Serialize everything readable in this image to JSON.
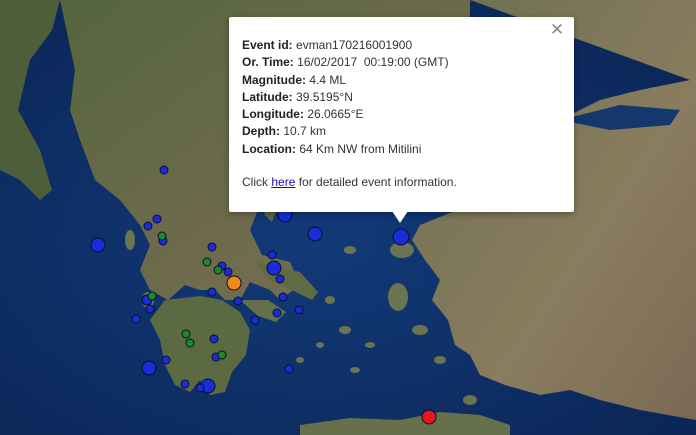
{
  "popup": {
    "event_id_label": "Event id:",
    "event_id": "evman170216001900",
    "time_label": "Or. Time:",
    "time": "16/02/2017  00:19:00 (GMT)",
    "magnitude_label": "Magnitude:",
    "magnitude": "4.4 ML",
    "latitude_label": "Latitude:",
    "latitude": "39.5195°N",
    "longitude_label": "Longitude:",
    "longitude": "26.0665°E",
    "depth_label": "Depth:",
    "depth": "10.7 km",
    "location_label": "Location:",
    "location": "64 Km NW from Mitilini",
    "click_prefix": "Click",
    "link_text": "here",
    "click_suffix": "for detailed event information.",
    "close_icon": "close-icon"
  },
  "colors": {
    "sea": "#0c2a5c",
    "land": "#4a5a38",
    "marker_blue": "#1a2bd8",
    "marker_green": "#1b8a2a",
    "marker_orange": "#f08a1c",
    "marker_red": "#e01a1a"
  },
  "markers": [
    {
      "color": "blue"
    },
    {
      "color": "blue"
    },
    {
      "color": "blue"
    },
    {
      "color": "blue"
    },
    {
      "color": "blue"
    },
    {
      "color": "blue"
    },
    {
      "color": "blue"
    },
    {
      "color": "blue"
    },
    {
      "color": "blue"
    },
    {
      "color": "blue"
    },
    {
      "color": "blue"
    },
    {
      "color": "blue"
    },
    {
      "color": "blue"
    },
    {
      "color": "blue"
    },
    {
      "color": "blue"
    },
    {
      "color": "blue"
    },
    {
      "color": "blue"
    },
    {
      "color": "blue"
    },
    {
      "color": "blue"
    },
    {
      "color": "blue"
    },
    {
      "color": "blue"
    },
    {
      "color": "blue"
    },
    {
      "color": "blue"
    },
    {
      "color": "blue"
    },
    {
      "color": "blue"
    },
    {
      "color": "blue"
    },
    {
      "color": "blue"
    },
    {
      "color": "blue"
    },
    {
      "color": "blue"
    },
    {
      "color": "blue"
    },
    {
      "color": "blue"
    },
    {
      "color": "green"
    },
    {
      "color": "green"
    },
    {
      "color": "green"
    },
    {
      "color": "green"
    },
    {
      "color": "green"
    },
    {
      "color": "green"
    },
    {
      "color": "green"
    },
    {
      "color": "orange"
    },
    {
      "color": "red"
    }
  ]
}
